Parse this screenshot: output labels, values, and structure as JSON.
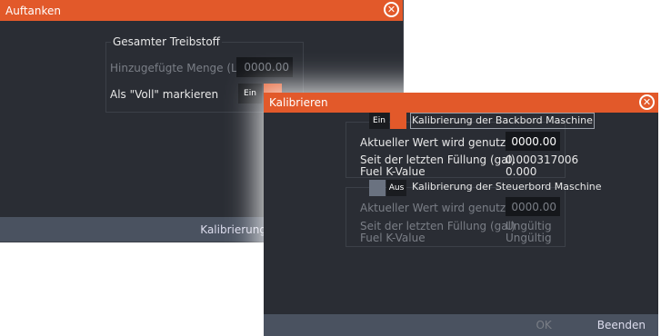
{
  "back_dialog": {
    "title": "Auftanken",
    "section_label": "Gesamter Treibstoff",
    "added_amount_label": "Hinzugefügte Menge (L)",
    "added_amount_value": "0000.00",
    "mark_full_label": "Als \"Voll\" markieren",
    "mark_full_toggle": "Ein",
    "calibrate_button": "Kalibrierung"
  },
  "front_dialog": {
    "title": "Kalibrieren",
    "port": {
      "toggle": "Ein",
      "title": "Kalibrierung der Backbord Maschine",
      "current_value_label": "Aktueller Wert wird genutzt (gal)",
      "current_value": "0000.00",
      "since_last_fill_label": "Seit der letzten Füllung (gal)",
      "since_last_fill_value": "0.000317006",
      "k_value_label": "Fuel K-Value",
      "k_value": "0.000"
    },
    "starboard": {
      "toggle": "Aus",
      "title": "Kalibrierung der Steuerbord Maschine",
      "current_value_label": "Aktueller Wert wird genutzt (gal)",
      "current_value": "0000.00",
      "since_last_fill_label": "Seit der letzten Füllung (gal)",
      "since_last_fill_value": "Ungültig",
      "k_value_label": "Fuel K-Value",
      "k_value": "Ungültig"
    },
    "ok_button": "OK",
    "exit_button": "Beenden"
  },
  "colors": {
    "accent": "#e2592a",
    "dialog_bg": "#2a2d34",
    "footer_bg": "#4a5260"
  }
}
